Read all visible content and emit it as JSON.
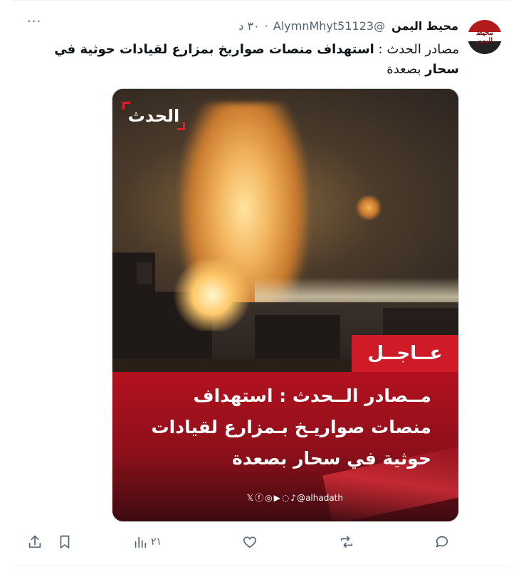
{
  "tweet": {
    "author_name": "محيط اليمن",
    "handle": "@AlymnMhyt51123",
    "separator": "·",
    "time": "٣٠ د",
    "more_label": "···",
    "text_prefix": "مصادر الحدث : ",
    "text_bold": "استهداف منصات صواريخ بمزارع لقيادات حوثية في سحار",
    "text_suffix": " بصعدة",
    "avatar_text": "محيط اليمن"
  },
  "media": {
    "logo_text": "الحدث",
    "urgent_label": "عــاجــل",
    "headline": "مــصادر الــحدث : استهداف منصات صواريـخ بـمزارع لقيادات حوثية في سحار بصعدة",
    "social_icons": [
      "x-icon",
      "facebook-icon",
      "instagram-icon",
      "youtube-icon",
      "whatsapp-icon",
      "tiktok-icon"
    ],
    "social_handle": "@alhadath"
  },
  "actions": {
    "views_count": "٢١"
  }
}
